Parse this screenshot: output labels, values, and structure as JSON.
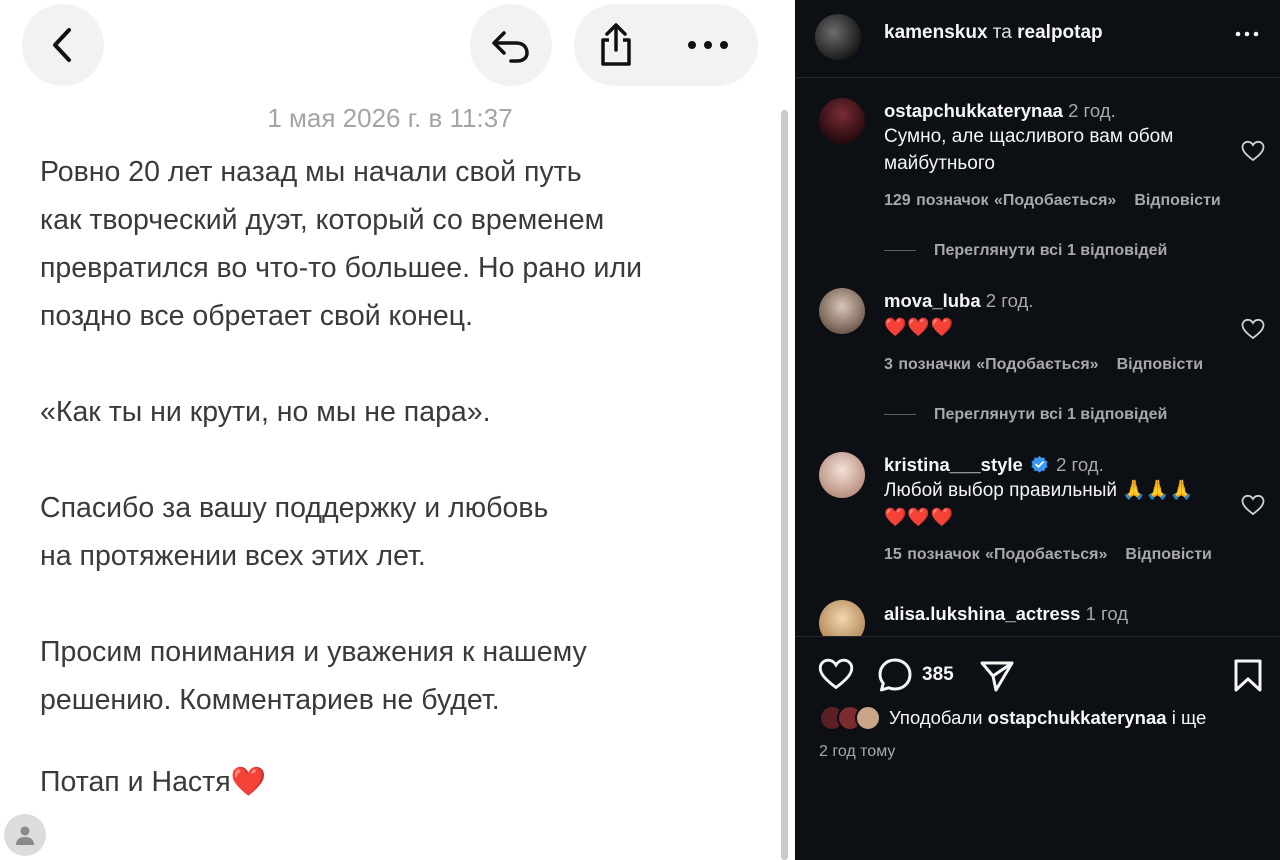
{
  "note": {
    "date": "1 мая 2026 г. в 11:37",
    "paragraphs": [
      [
        "Ровно 20 лет назад мы начали свой путь",
        "как творческий дуэт, который со временем",
        "превратился во что-то большее. Но рано или",
        "поздно все обретает свой конец."
      ],
      [
        "«Как ты ни крути, но мы не пара»."
      ],
      [
        "Спасибо за вашу поддержку и любовь",
        "на протяжении всех этих лет."
      ],
      [
        "Просим понимания и уважения к нашему",
        "решению. Комментариев не будет."
      ],
      [
        "Потап и Настя"
      ]
    ],
    "signature_emoji": "❤️",
    "icons": {
      "back": "chevron-left-icon",
      "undo": "undo-icon",
      "share": "share-icon",
      "more": "more-horizontal-icon",
      "profile": "person-icon"
    }
  },
  "instagram": {
    "header": {
      "user1": "kamenskux",
      "conj": "та",
      "user2": "realpotap"
    },
    "comments": [
      {
        "username": "ostapchukkaterynaa",
        "time": "2 год.",
        "text_lines": [
          "Сумно, але щасливого вам обом",
          "майбутнього"
        ],
        "likes": "129 позначок «Подобається»",
        "reply": "Відповісти",
        "view_replies": "Переглянути всі 1 відповідей"
      },
      {
        "username": "mova_luba",
        "time": "2 год.",
        "text_lines": [
          "❤️❤️❤️"
        ],
        "likes": "3 позначки «Подобається»",
        "reply": "Відповісти",
        "view_replies": "Переглянути всі 1 відповідей"
      },
      {
        "username": "kristina___style",
        "verified": true,
        "time": "2 год.",
        "text_lines": [
          "Любой выбор правильный 🙏🙏🙏",
          "❤️❤️❤️"
        ],
        "likes": "15 позначок «Подобається»",
        "reply": "Відповісти"
      },
      {
        "username": "alisa.lukshina_actress",
        "time": "1 год"
      }
    ],
    "footer": {
      "comment_count": "385",
      "liked_by_prefix": "Уподобали",
      "liked_by_user": "ostapchukkaterynaa",
      "liked_by_suffix": "і ще",
      "post_time": "2 год тому"
    },
    "colors": {
      "background": "#0c0f14",
      "heart_red": "#ef2b45",
      "verified_blue": "#3897f0"
    }
  }
}
